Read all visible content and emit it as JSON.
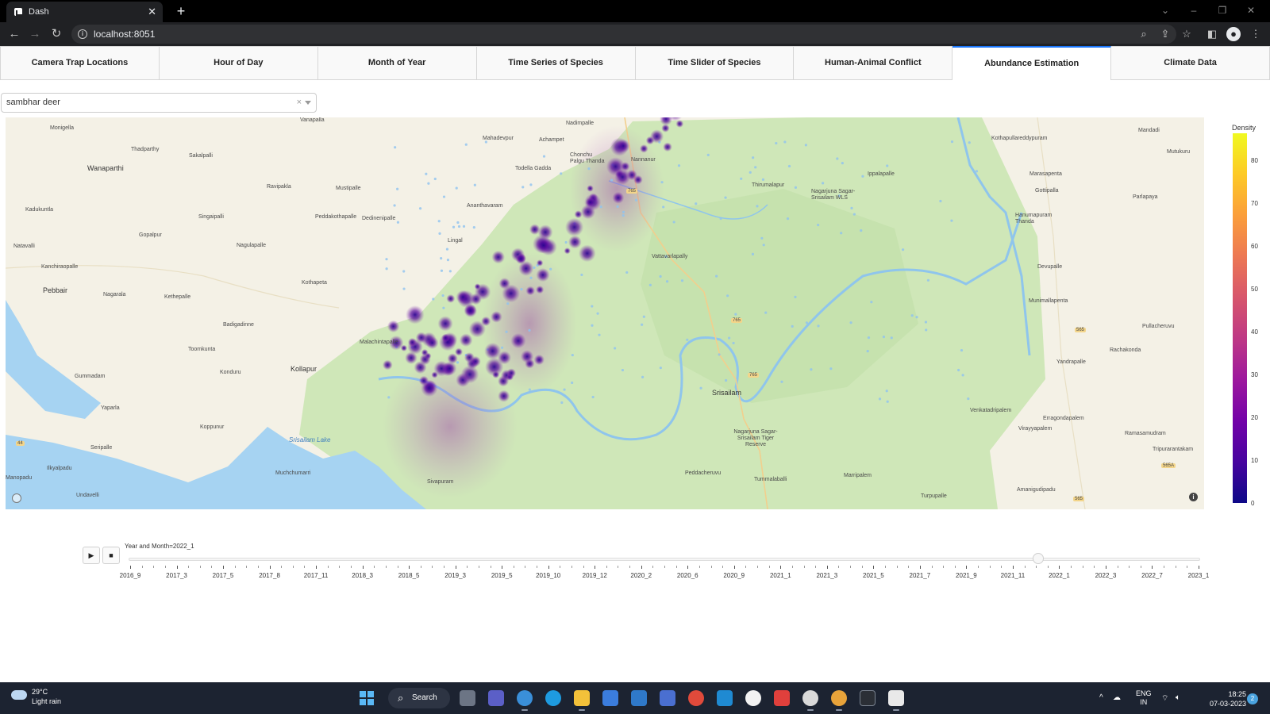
{
  "browser": {
    "tab_title": "Dash",
    "new_tab": "+",
    "url": "localhost:8051"
  },
  "app": {
    "tabs": [
      {
        "label": "Camera Trap Locations"
      },
      {
        "label": "Hour of Day"
      },
      {
        "label": "Month of Year"
      },
      {
        "label": "Time Series of Species"
      },
      {
        "label": "Time Slider of Species"
      },
      {
        "label": "Human-Animal Conflict"
      },
      {
        "label": "Abundance Estimation",
        "active": true
      },
      {
        "label": "Climate Data"
      }
    ],
    "dropdown": {
      "value": "sambhar deer",
      "clear": "×"
    }
  },
  "map": {
    "places": [
      "Monigella",
      "Vanapalla",
      "Nadimpalle",
      "Mahadevpur",
      "Achampet",
      "Chonchu Palgu Thanda",
      "Todella Gadda",
      "Nannanur",
      "Thirumalapur",
      "Nagarjuna Sagar-Srisailam WLS",
      "Ippalapalle",
      "Kothapullareddypuram",
      "Mandadi",
      "Mutukuru",
      "Marasapenta",
      "Gottipalla",
      "Parlapaya",
      "Hanumapuram Thanda",
      "Thadparthy",
      "Sakalpalli",
      "Wanaparthi",
      "Ravipakla",
      "Mustipalle",
      "Kadukuntla",
      "Singaipalli",
      "Peddakothapalle",
      "Dedinenipalle",
      "Ananthavaram",
      "Gopalpur",
      "Lingal",
      "Natavalli",
      "Nagulapalle",
      "Vattavarlapally",
      "Kanchiraopalle",
      "Devupalle",
      "Pebbair",
      "Nagarala",
      "Kethepalle",
      "Kothapeta",
      "Munimallapenta",
      "Badigadinne",
      "Pullacheruvu",
      "Toomkunta",
      "Malachintapalle",
      "Rachakonda",
      "Konduru",
      "Kollapur",
      "Yandrapalle",
      "Gummadam",
      "Srisailam",
      "Yaparla",
      "Venkatadripalem",
      "Erragondapalem",
      "Koppunur",
      "Virayyapalem",
      "Ramasamudram",
      "Seripalle",
      "Srisailam Lake",
      "Nagarjuna Sagar-Srisailam Tiger Reserve",
      "Tripurarantakam",
      "Ilkyalpadu",
      "Muchchumarri",
      "Sivapuram",
      "Peddacheruvu",
      "Tummalaballi",
      "Marripalem",
      "Amanigudipadu",
      "Turpupalle",
      "Manopadu",
      "Undavelli"
    ],
    "road_shields": [
      "765",
      "765",
      "765",
      "565",
      "44",
      "565",
      "565A"
    ]
  },
  "colorbar": {
    "title": "Density",
    "ticks": [
      "0",
      "10",
      "20",
      "30",
      "40",
      "50",
      "60",
      "70",
      "80"
    ],
    "colorscale": [
      "#0d0887",
      "#46039f",
      "#7201a8",
      "#9c179e",
      "#bd3786",
      "#d8576b",
      "#ed7953",
      "#fb9f3a",
      "#fdca26",
      "#f0f921"
    ]
  },
  "slider": {
    "play_label": "▶",
    "stop_label": "■",
    "current_label": "Year and Month=2022_1",
    "selected_fraction": 0.85,
    "labels": [
      "2016_9",
      "2017_3",
      "2017_5",
      "2017_8",
      "2017_11",
      "2018_3",
      "2018_5",
      "2019_3",
      "2019_5",
      "2019_10",
      "2019_12",
      "2020_2",
      "2020_6",
      "2020_9",
      "2021_1",
      "2021_3",
      "2021_5",
      "2021_7",
      "2021_9",
      "2021_11",
      "2022_1",
      "2022_3",
      "2022_7",
      "2023_1"
    ]
  },
  "taskbar": {
    "temperature": "29°C",
    "weather": "Light rain",
    "search_label": "Search",
    "lang_1": "ENG",
    "lang_2": "IN",
    "time": "18:25",
    "date": "07-03-2023",
    "notifications": "2"
  }
}
